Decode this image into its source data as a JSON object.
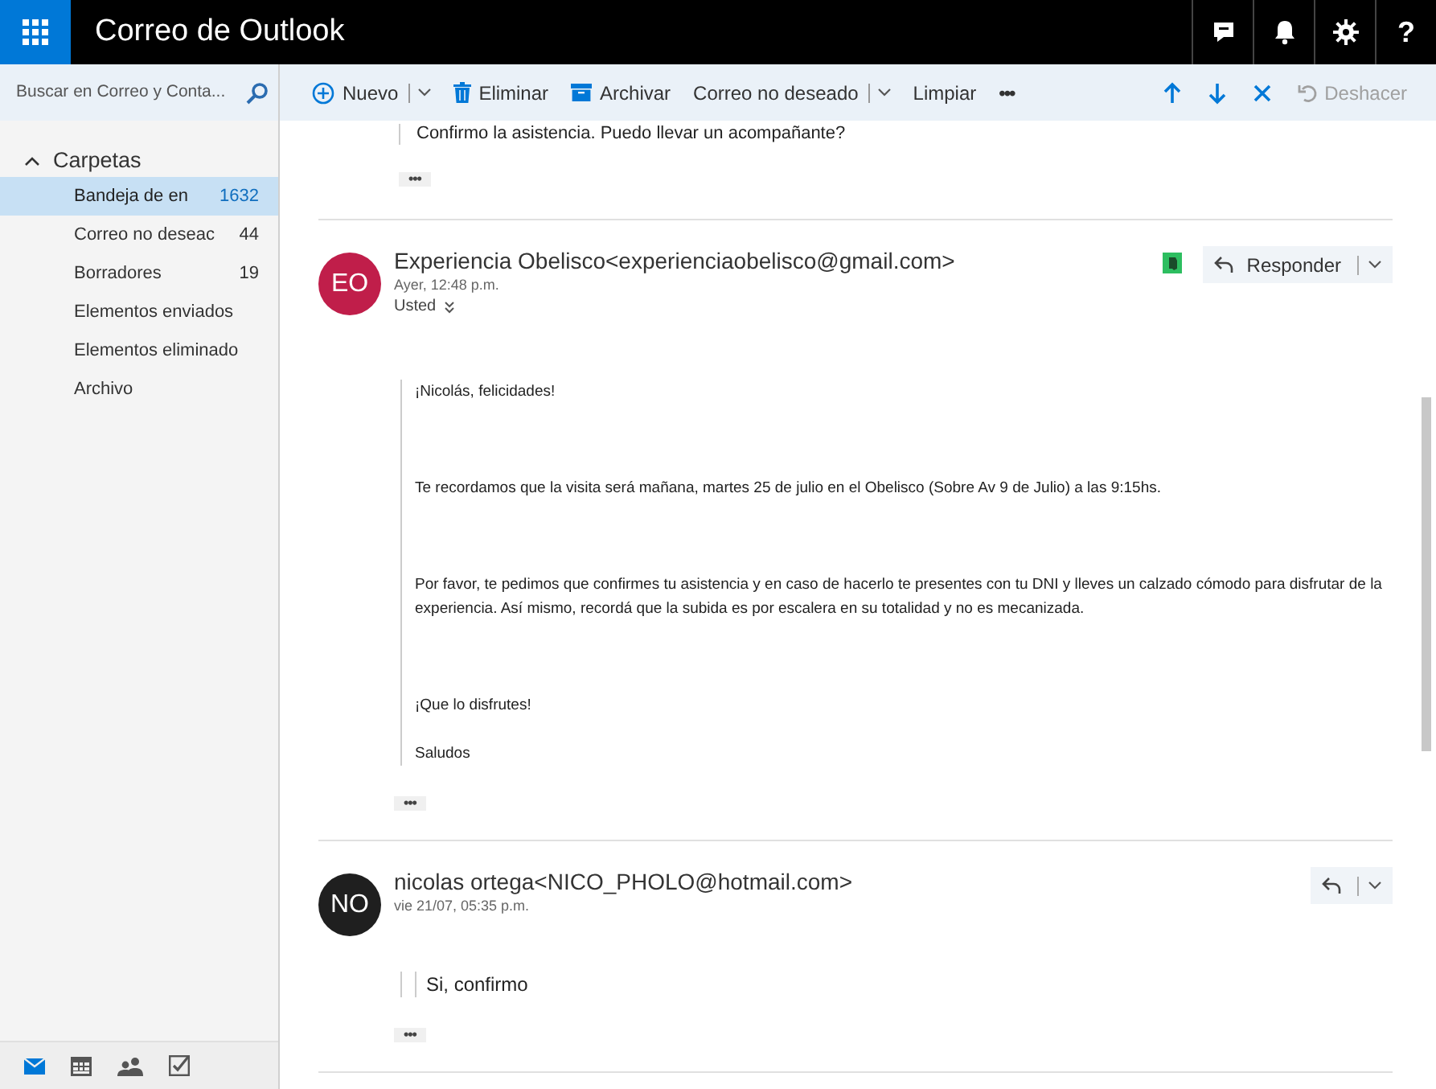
{
  "app": {
    "title": "Correo de Outlook"
  },
  "header_buttons": [
    {
      "kind": "chat"
    },
    {
      "kind": "bell"
    },
    {
      "kind": "gear"
    },
    {
      "kind": "help",
      "label": "?"
    }
  ],
  "search": {
    "placeholder": "Buscar en Correo y Conta..."
  },
  "folders": {
    "label": "Carpetas",
    "expanded": true,
    "items": [
      {
        "label": "Bandeja de en",
        "count": "1632",
        "selected": true
      },
      {
        "label": "Correo no deseac",
        "count": "44",
        "selected": false
      },
      {
        "label": "Borradores",
        "count": "19",
        "selected": false
      },
      {
        "label": "Elementos enviados",
        "selected": false
      },
      {
        "label": "Elementos eliminado",
        "selected": false
      },
      {
        "label": "Archivo",
        "selected": false
      }
    ]
  },
  "nav_modules": [
    {
      "kind": "mail",
      "selected": true
    },
    {
      "kind": "calendar",
      "selected": false
    },
    {
      "kind": "people",
      "selected": false
    },
    {
      "kind": "tasks",
      "selected": false
    }
  ],
  "toolbar": [
    {
      "kind": "new",
      "label": "Nuevo",
      "dropdown": true
    },
    {
      "kind": "delete",
      "label": "Eliminar"
    },
    {
      "kind": "archive",
      "label": "Archivar"
    },
    {
      "kind": "plain",
      "label": "Correo no deseado",
      "dropdown": true
    },
    {
      "kind": "plain",
      "label": "Limpiar"
    },
    {
      "kind": "more",
      "label": "•••"
    }
  ],
  "toolbar_right": [
    {
      "kind": "up"
    },
    {
      "kind": "down"
    },
    {
      "kind": "close"
    },
    {
      "kind": "undo",
      "label": "Deshacer",
      "disabled": true
    }
  ],
  "previous_message_tail": {
    "quote": "Confirmo la asistencia. Puedo llevar un acompañante?",
    "more": "•••"
  },
  "messages": [
    {
      "initials": "EO",
      "color": "#c01e4a",
      "sender": "Experiencia Obelisco<experienciaobelisco@gmail.com>",
      "date": "Ayer, 12:48 p.m.",
      "to": "Usted",
      "addin": true,
      "reply_label": "Responder",
      "quoted": false,
      "body": [
        "¡Nicolás, felicidades!",
        "Te recordamos que la visita será mañana, martes 25 de julio en el Obelisco (Sobre Av 9 de Julio) a las 9:15hs.",
        "Por favor, te pedimos que confirmes tu asistencia y en caso de hacerlo te presentes con tu DNI y lleves un calzado cómodo para disfrutar de la experiencia. Así mismo, recordá que la subida es por escalera en su totalidad y no es mecanizada.",
        "¡Que lo disfrutes!",
        "Saludos"
      ],
      "more": "•••"
    },
    {
      "initials": "NO",
      "color": "#1f1f1f",
      "sender": "nicolas ortega<NICO_PHOLO@hotmail.com>",
      "date": "vie 21/07, 05:35 p.m.",
      "addin": false,
      "quoted": true,
      "body": [
        "Si, confirmo"
      ],
      "more": "•••"
    }
  ]
}
